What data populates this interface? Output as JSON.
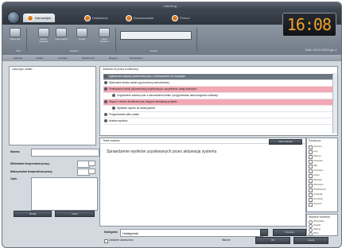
{
  "window": {
    "title": "eMeeting ..."
  },
  "ribbon": {
    "tabs": [
      {
        "label": "Harmonijek"
      },
      {
        "label": "Ustawienia"
      },
      {
        "label": "Dostosowanie"
      },
      {
        "label": "Pomoc"
      }
    ],
    "buttons": [
      {
        "label": "Nowy plik"
      },
      {
        "label": "Zapisz kolekcje"
      },
      {
        "label": "Lista zadań"
      },
      {
        "label": "Dodaj"
      },
      {
        "label": "Usuń zadanie"
      }
    ],
    "groups": [
      {
        "label": "Pliki"
      },
      {
        "label": "Zadania"
      },
      {
        "label": "Szukaj"
      }
    ],
    "search_placeholder": ""
  },
  "clock": {
    "time": "16:08",
    "caption": "Dziś: 04.02.2013 (pn.)"
  },
  "subtabs": [
    {
      "label": "Zadania"
    },
    {
      "label": "Notatki"
    },
    {
      "label": "Kontakty"
    },
    {
      "label": "Wydarzenia"
    },
    {
      "label": "Raporty"
    },
    {
      "label": "Zarządzanie"
    }
  ],
  "left_panel": {
    "list_header": "Lista typu zadań",
    "name_label": "Nazwa:",
    "min_temp_label": "Minimalna temperatura pracy:",
    "max_temp_label": "Maksymalna temperatura pracy:",
    "desc_label": "Opis:",
    "add_button": "Dodaj",
    "delete_button": "Usuń"
  },
  "list_panel": {
    "header": "Zadania do pracy konstrukcji",
    "rows": [
      {
        "text": "Zgłoszenie naprawy systemowej wraz z przekazaniem do przeglądu",
        "style": "grey",
        "indent": 0
      },
      {
        "text": "Wykonanie testów zadań wg procedury wdrożeniowej",
        "style": "normal",
        "indent": 0
      },
      {
        "text": "Przekazanie pełnej dokumentacji projektowej po uzupełnieniu uwag testowych",
        "style": "pink",
        "indent": 0
      },
      {
        "text": "Uzgodnienie zakresu prac z kierownikiem działu i przygotowanie harmonogramu realizacji",
        "style": "normal",
        "indent": 1
      },
      {
        "text": "Raport z testów dla klienta oraz wstępna akceptacja projektu",
        "style": "pink",
        "indent": 0
      },
      {
        "text": "Wysłanie raportu do działu jakości",
        "style": "normal",
        "indent": 1
      },
      {
        "text": "Przygotowanie pliku zadań",
        "style": "normal",
        "indent": 0
      },
      {
        "text": "Analiza wyników",
        "style": "normal",
        "indent": 0
      }
    ]
  },
  "editor": {
    "header": "Tekst zadania",
    "tab_label": "Opis zadania",
    "content": "Sprawdzenie wyników uzyskiwanych przez aktywację systemu",
    "category_label": "Kategoria:",
    "category_value": "Ustalgórnik",
    "priority_label": "Priorytet",
    "ok_button": "OK",
    "cancel_button": "Anuluj",
    "done_label": "Zadanie ukończono",
    "progress_label": "Ważne"
  },
  "right_panel": {
    "header": "Szukaj za",
    "items": [
      "Styczeń",
      "Luty",
      "Marzec",
      "Kwiecień",
      "Maj",
      "Czerwiec",
      "Lipiec",
      "Sierpień",
      "Wrzesień",
      "Październik",
      "Listopad",
      "Grudzień",
      "Styczeń"
    ],
    "filter_header": "Wybierz kontekst",
    "filter_items": [
      "Wszystkie",
      "Zwykłe",
      "Ważne",
      "Pilne"
    ]
  },
  "colors": {
    "accent_orange": "#f1a12b",
    "pink_row": "#f2a9b3",
    "dark_ui": "#3a424c"
  }
}
